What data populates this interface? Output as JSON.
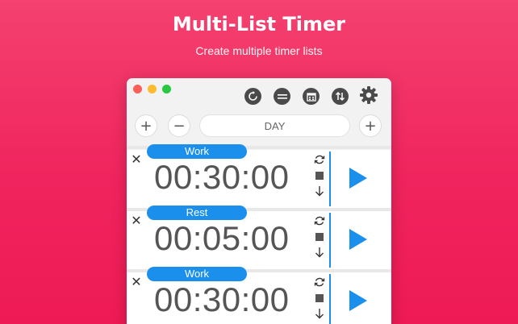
{
  "hero": {
    "title": "Multi-List Timer",
    "subtitle": "Create multiple timer lists"
  },
  "toolbar": {
    "icons": [
      "reset-all-icon",
      "list-icon",
      "calendar-icon",
      "sort-icon",
      "gear-icon"
    ]
  },
  "controls": {
    "add_left": "+",
    "remove": "−",
    "list_name": "DAY",
    "add_right": "+"
  },
  "timers": [
    {
      "label": "Work",
      "time": "00:30:00",
      "close": "✕"
    },
    {
      "label": "Rest",
      "time": "00:05:00",
      "close": "✕"
    },
    {
      "label": "Work",
      "time": "00:30:00",
      "close": "✕"
    }
  ],
  "colors": {
    "background": "#f0245e",
    "accent": "#1a8fec",
    "window": "#f2f2f2"
  }
}
